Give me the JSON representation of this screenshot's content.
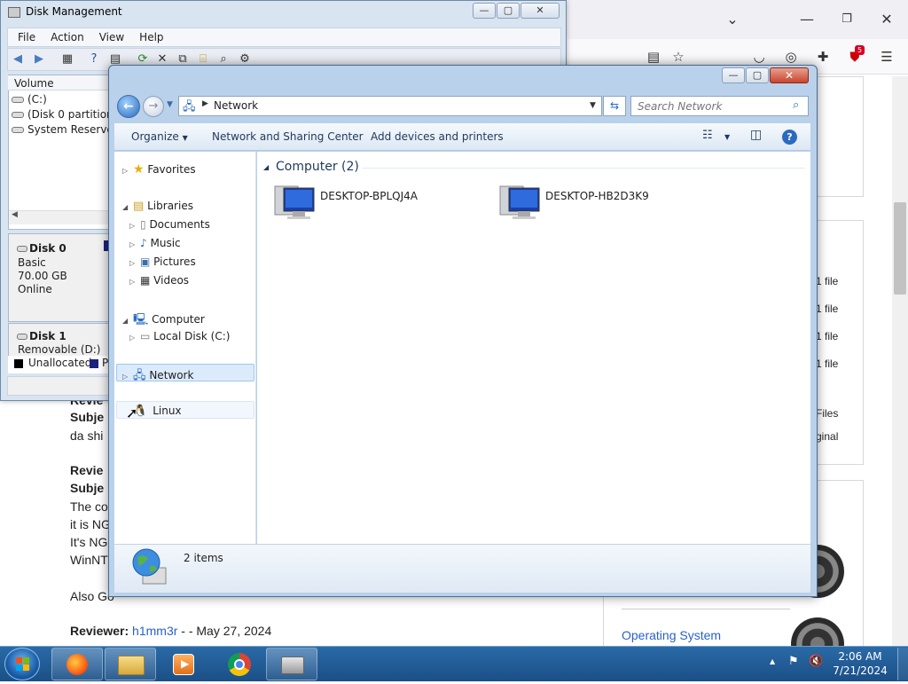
{
  "browser": {
    "file_counts": [
      "1 file",
      "1 file",
      "1 file",
      "1 file"
    ],
    "files_label": "Files",
    "original_label": "ginal",
    "badge": "5",
    "reviews": [
      {
        "line1": "Revie",
        "line2": "Subje",
        "line3": "da shi"
      },
      {
        "line1": "Revie",
        "line2": "Subje",
        "line3": "The co",
        "line4": "it is NG",
        "line5": "It's NG",
        "line6": "WinNT"
      }
    ],
    "also_text": "Also Go",
    "last_review": {
      "reviewer_label": "Reviewer:",
      "reviewer_name": "h1mm3r",
      "date": " - - May 27, 2024"
    },
    "category_link": "Operating System"
  },
  "disk_management": {
    "title": "Disk Management",
    "menu": [
      "File",
      "Action",
      "View",
      "Help"
    ],
    "list_header": "Volume",
    "volumes": [
      "(C:)",
      "(Disk 0 partition 3",
      "System Reserved"
    ],
    "disk0": {
      "name": "Disk 0",
      "type": "Basic",
      "size": "70.00 GB",
      "status": "Online"
    },
    "disk1": {
      "name": "Disk 1",
      "type": "Removable (D:)"
    },
    "legend": {
      "unallocated": "Unallocated",
      "primary": "P"
    }
  },
  "explorer": {
    "breadcrumb": "Network",
    "search_placeholder": "Search Network",
    "commands": {
      "organize": "Organize",
      "network_center": "Network and Sharing Center",
      "add_devices": "Add devices and printers"
    },
    "nav": {
      "favorites": "Favorites",
      "libraries": "Libraries",
      "documents": "Documents",
      "music": "Music",
      "pictures": "Pictures",
      "videos": "Videos",
      "computer": "Computer",
      "local_disk": "Local Disk (C:)",
      "network": "Network",
      "linux": "Linux"
    },
    "group_header": "Computer (2)",
    "computers": [
      "DESKTOP-BPLQJ4A",
      "DESKTOP-HB2D3K9"
    ],
    "status": "2 items"
  },
  "taskbar": {
    "time": "2:06 AM",
    "date": "7/21/2024"
  },
  "colors": {
    "accent": "#1e395b",
    "link": "#2a60c8",
    "taskbar": "#1b4f86",
    "selection": "#cce8ff"
  }
}
